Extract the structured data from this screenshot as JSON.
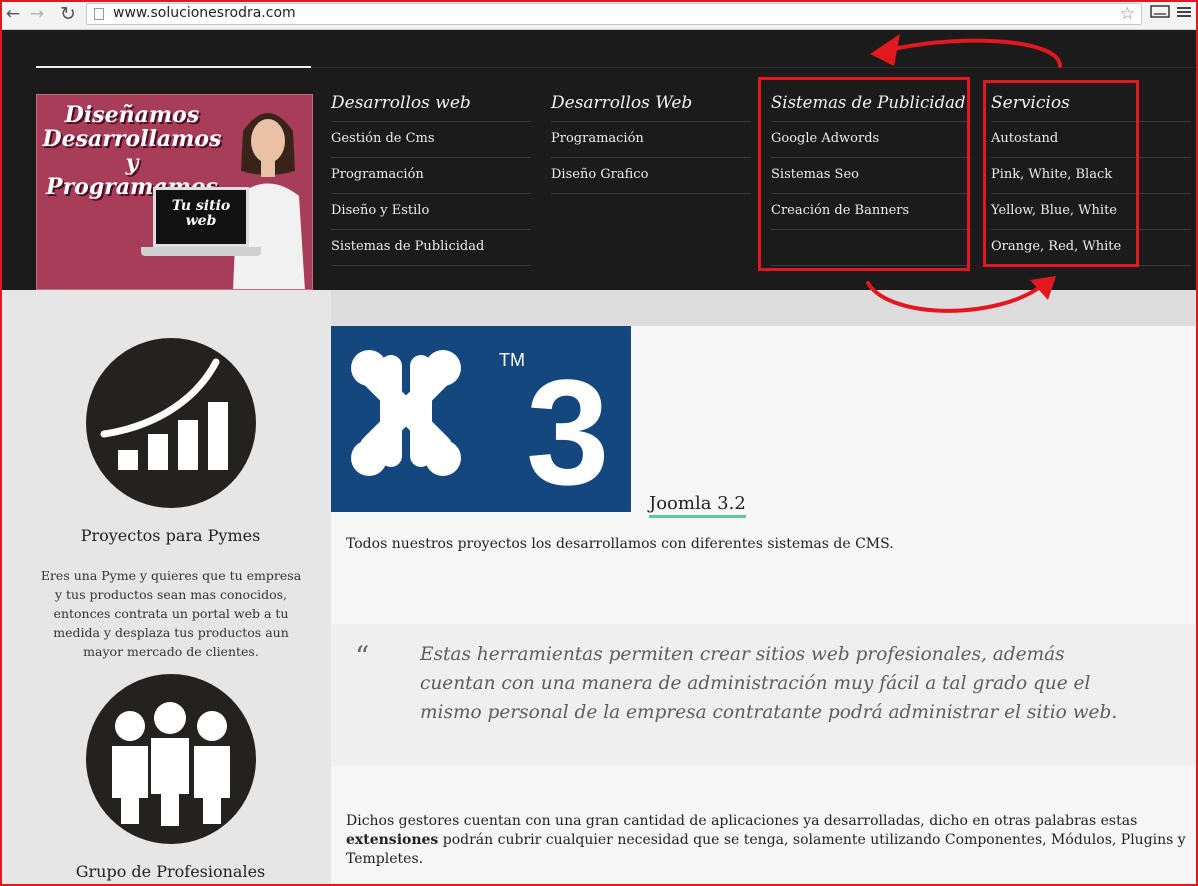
{
  "browser": {
    "url": "www.solucionesrodra.com",
    "back_glyph": "←",
    "forward_glyph": "→",
    "reload_glyph": "↻",
    "star_glyph": "☆"
  },
  "banner": {
    "line1": "Diseñamos",
    "line2": "Desarrollamos",
    "line3": "y Programamos",
    "laptop_line1": "Tu sitio",
    "laptop_line2": "web"
  },
  "menu": {
    "columns": [
      {
        "title": "Desarrollos web",
        "items": [
          "Gestión de Cms",
          "Programación",
          "Diseño y Estilo",
          "Sistemas de Publicidad"
        ]
      },
      {
        "title": "Desarrollos Web",
        "items": [
          "Programación",
          "Diseño Grafico"
        ]
      },
      {
        "title": "Sistemas de Publicidad",
        "items": [
          "Google Adwords",
          "Sistemas Seo",
          "Creación de Banners"
        ]
      },
      {
        "title": "Servicios",
        "items": [
          "Autostand",
          "Pink, White, Black",
          "Yellow, Blue, White",
          "Orange, Red, White"
        ]
      }
    ]
  },
  "annotation_color": "#e3181f",
  "features": [
    {
      "title": "Proyectos para Pymes",
      "text": "Eres una Pyme y quieres que tu empresa y tus productos sean mas conocidos, entonces contrata un portal web a tu medida y desplaza tus productos aun mayor mercado de clientes.",
      "icon": "growth-chart-icon"
    },
    {
      "title": "Grupo de Profesionales",
      "icon": "team-people-icon"
    }
  ],
  "article": {
    "image_label": "3",
    "image_tm": "TM",
    "link": "Joomla 3.2",
    "intro": "Todos nuestros proyectos los desarrollamos con diferentes  sistemas de CMS.",
    "quote_mark": "“",
    "quote": "Estas herramientas permiten crear sitios web  profesionales, además cuentan con una manera de administración muy fácil a tal grado que el mismo personal de la empresa contratante  podrá administrar el sitio web.",
    "body_before": "Dichos gestores  cuentan con una gran cantidad de aplicaciones ya desarrolladas, dicho en otras palabras estas ",
    "body_bold": "extensiones",
    "body_after": " podrán cubrir cualquier necesidad que se tenga, solamente utilizando Componentes, Módulos, Plugins y Templetes."
  }
}
